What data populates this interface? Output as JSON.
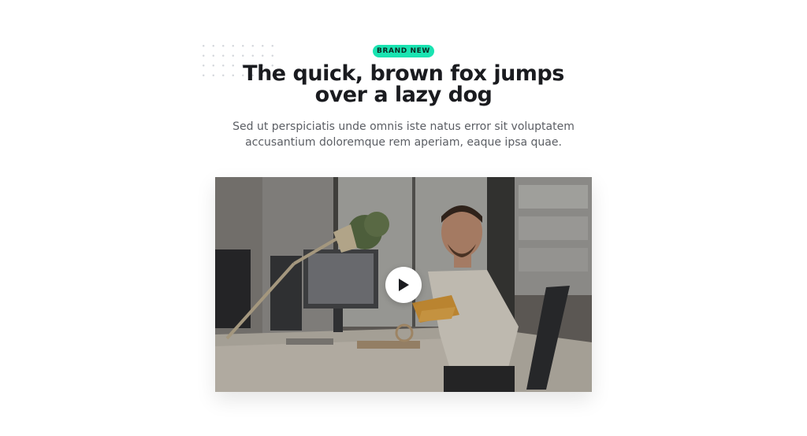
{
  "hero": {
    "badge": "BRAND NEW",
    "title_line1": "The quick, brown fox jumps",
    "title_line2": "over a lazy dog",
    "subtitle_line1": "Sed ut perspiciatis unde omnis iste natus error sit voluptatem",
    "subtitle_line2": "accusantium doloremque rem aperiam, eaque ipsa quae."
  },
  "video": {
    "play_icon": "play-icon"
  },
  "colors": {
    "badge_bg": "#19e3b1",
    "title": "#1a1b1f",
    "body_text": "#5b5e64"
  }
}
